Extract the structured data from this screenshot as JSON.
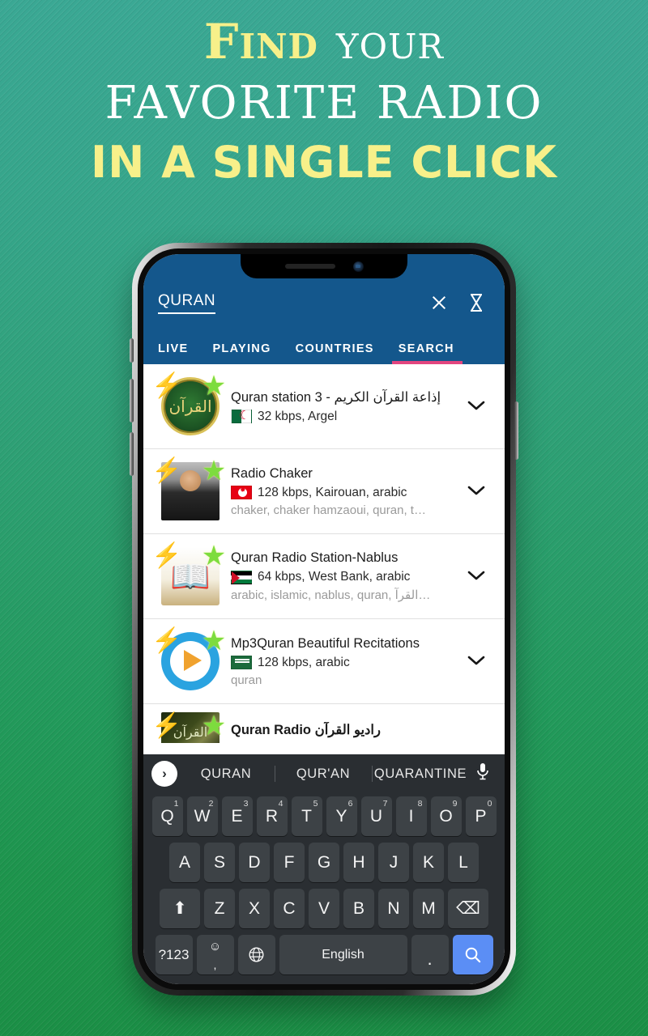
{
  "promo": {
    "line1_emphasis": "Find",
    "line1_rest": "your",
    "line2": "favorite radio",
    "line3": "in a single click",
    "accent_yellow": "#f7f08a",
    "white": "#ffffff",
    "bg_top": "#3aa894",
    "bg_bottom": "#1b8f46"
  },
  "app": {
    "bar_color": "#14578c",
    "active_tab_color": "#e2457f",
    "search_query": "QURAN",
    "icons": {
      "close": "close-icon",
      "timer": "hourglass-icon"
    },
    "tabs": [
      {
        "label": "LIVE",
        "active": false
      },
      {
        "label": "PLAYING",
        "active": false
      },
      {
        "label": "COUNTRIES",
        "active": false
      },
      {
        "label": "SEARCH",
        "active": true
      }
    ],
    "stations": [
      {
        "title": "Quran station 3 - إذاعة القرآن الكريم",
        "meta": "32 kbps, Argel",
        "tags": "",
        "flag": "flag-dz",
        "thumb": "t-quran"
      },
      {
        "title": "Radio Chaker",
        "meta": "128 kbps, Kairouan, arabic",
        "tags": "chaker, chaker hamzaoui, quran, t…",
        "flag": "flag-tn",
        "thumb": "t-person"
      },
      {
        "title": "Quran Radio Station-Nablus",
        "meta": "64 kbps, West Bank, arabic",
        "tags": "arabic, islamic, nablus, quran, القرآ…",
        "flag": "flag-ps",
        "thumb": "t-book"
      },
      {
        "title": "Mp3Quran Beautiful Recitations",
        "meta": "128 kbps, arabic",
        "tags": "quran",
        "flag": "flag-sa",
        "thumb": "t-play"
      }
    ],
    "partial_station": {
      "title": "Quran Radio راديو القرآن",
      "thumb": "t-dark"
    },
    "expand_icon": "chevron-down-icon"
  },
  "keyboard": {
    "go_icon": "›",
    "mic_icon": "mic-icon",
    "suggestions": [
      "QURAN",
      "QUR'AN",
      "QUARANTINE"
    ],
    "row1": [
      {
        "k": "Q",
        "n": "1"
      },
      {
        "k": "W",
        "n": "2"
      },
      {
        "k": "E",
        "n": "3"
      },
      {
        "k": "R",
        "n": "4"
      },
      {
        "k": "T",
        "n": "5"
      },
      {
        "k": "Y",
        "n": "6"
      },
      {
        "k": "U",
        "n": "7"
      },
      {
        "k": "I",
        "n": "8"
      },
      {
        "k": "O",
        "n": "9"
      },
      {
        "k": "P",
        "n": "0"
      }
    ],
    "row2": [
      "A",
      "S",
      "D",
      "F",
      "G",
      "H",
      "J",
      "K",
      "L"
    ],
    "row3_shift": "⬆",
    "row3": [
      "Z",
      "X",
      "C",
      "V",
      "B",
      "N",
      "M"
    ],
    "row3_backspace": "⌫",
    "numeric_key": "?123",
    "emoji_key": "☺",
    "comma_key": ",",
    "globe_key": "🌐",
    "space_label": "English",
    "period_key": ".",
    "search_key": "search-icon",
    "search_key_color": "#5b8ef5"
  }
}
